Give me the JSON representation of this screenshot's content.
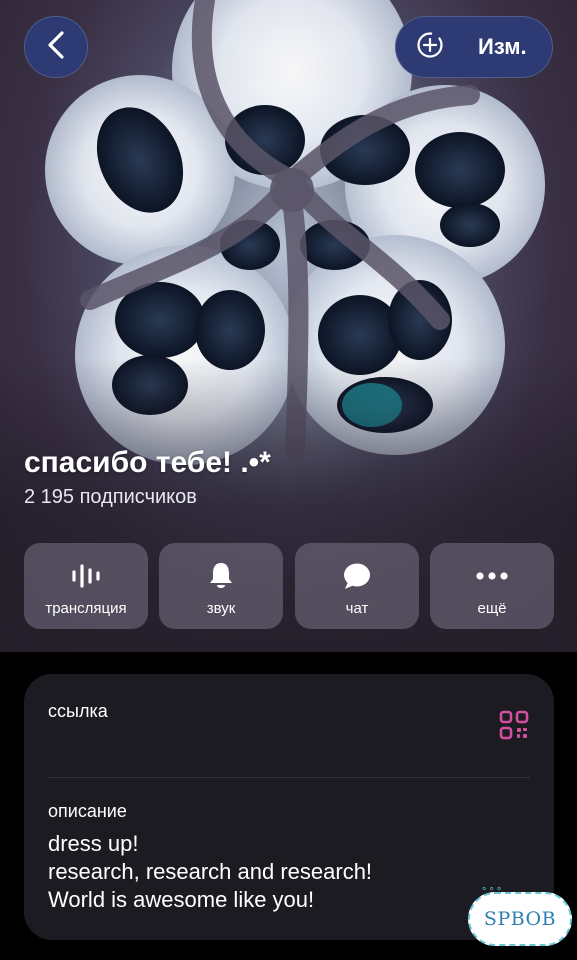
{
  "header": {
    "edit_label": "Изм.",
    "title": "спасибо тебе! .•*",
    "subscribers": "2 195 подписчиков"
  },
  "actions": [
    {
      "label": "трансляция",
      "icon": "soundwave-icon"
    },
    {
      "label": "звук",
      "icon": "bell-icon"
    },
    {
      "label": "чат",
      "icon": "chat-bubble-icon"
    },
    {
      "label": "ещё",
      "icon": "more-dots-icon"
    }
  ],
  "info": {
    "link_label": "ссылка",
    "description_label": "описание",
    "description_lines": [
      "dress up!",
      "research, research and research!",
      "World is awesome like you!"
    ]
  },
  "watermark": "SPBOB",
  "colors": {
    "button_bg": "#2d3a73",
    "card_bg": "#1c1b22",
    "qr_accent": "#d24fa0"
  }
}
